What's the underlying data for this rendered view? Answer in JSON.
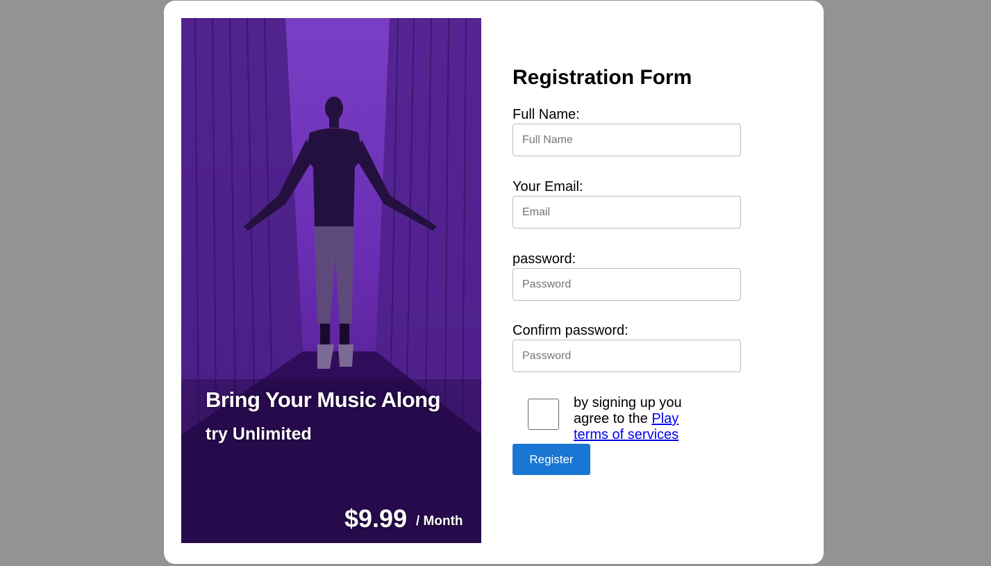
{
  "promo": {
    "headline": "Bring Your Music Along",
    "subline": "try Unlimited",
    "price": "$9.99",
    "period": "/ Month"
  },
  "form": {
    "title": "Registration Form",
    "fields": [
      {
        "label": "Full Name:",
        "placeholder": "Full Name",
        "value": ""
      },
      {
        "label": "Your Email:",
        "placeholder": "Email",
        "value": ""
      },
      {
        "label": "password:",
        "placeholder": "Password",
        "value": ""
      },
      {
        "label": "Confirm password:",
        "placeholder": "Password",
        "value": ""
      }
    ],
    "terms": {
      "prefix": "by signing up you agree to the",
      "link_text": "Play terms of services",
      "checked": false
    },
    "register_label": "Register"
  },
  "colors": {
    "page_background": "#939393",
    "card_background": "#ffffff",
    "promo_tint": "#7a3fc4",
    "button": "#1976d2",
    "link": "#0000ee"
  }
}
